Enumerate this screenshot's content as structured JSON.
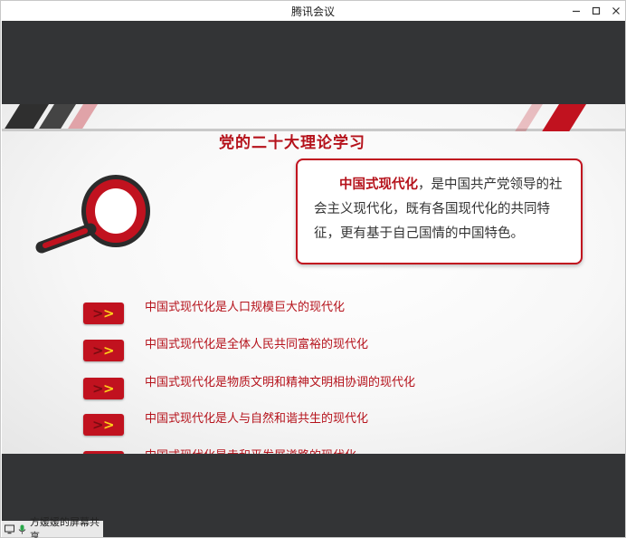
{
  "window": {
    "title": "腾讯会议",
    "minimize_symbol": "—",
    "maximize_symbol": "☐",
    "close_symbol": "✕"
  },
  "slide": {
    "title": "党的二十大理论学习",
    "callout": {
      "highlight": "中国式现代化",
      "text": "，是中国共产党领导的社会主义现代化，既有各国现代化的共同特征，更有基于自己国情的中国特色。"
    },
    "points": [
      "中国式现代化是人口规模巨大的现代化",
      "中国式现代化是全体人民共同富裕的现代化",
      "中国式现代化是物质文明和精神文明相协调的现代化",
      "中国式现代化是人与自然和谐共生的现代化",
      "中国式现代化是走和平发展道路的现代化"
    ],
    "bullet_glyph": ">",
    "accent_color": "#c1121f"
  },
  "status": {
    "share_label": "方媛媛的屏幕共享",
    "icons": [
      "screen-share-icon",
      "microphone-icon"
    ]
  }
}
